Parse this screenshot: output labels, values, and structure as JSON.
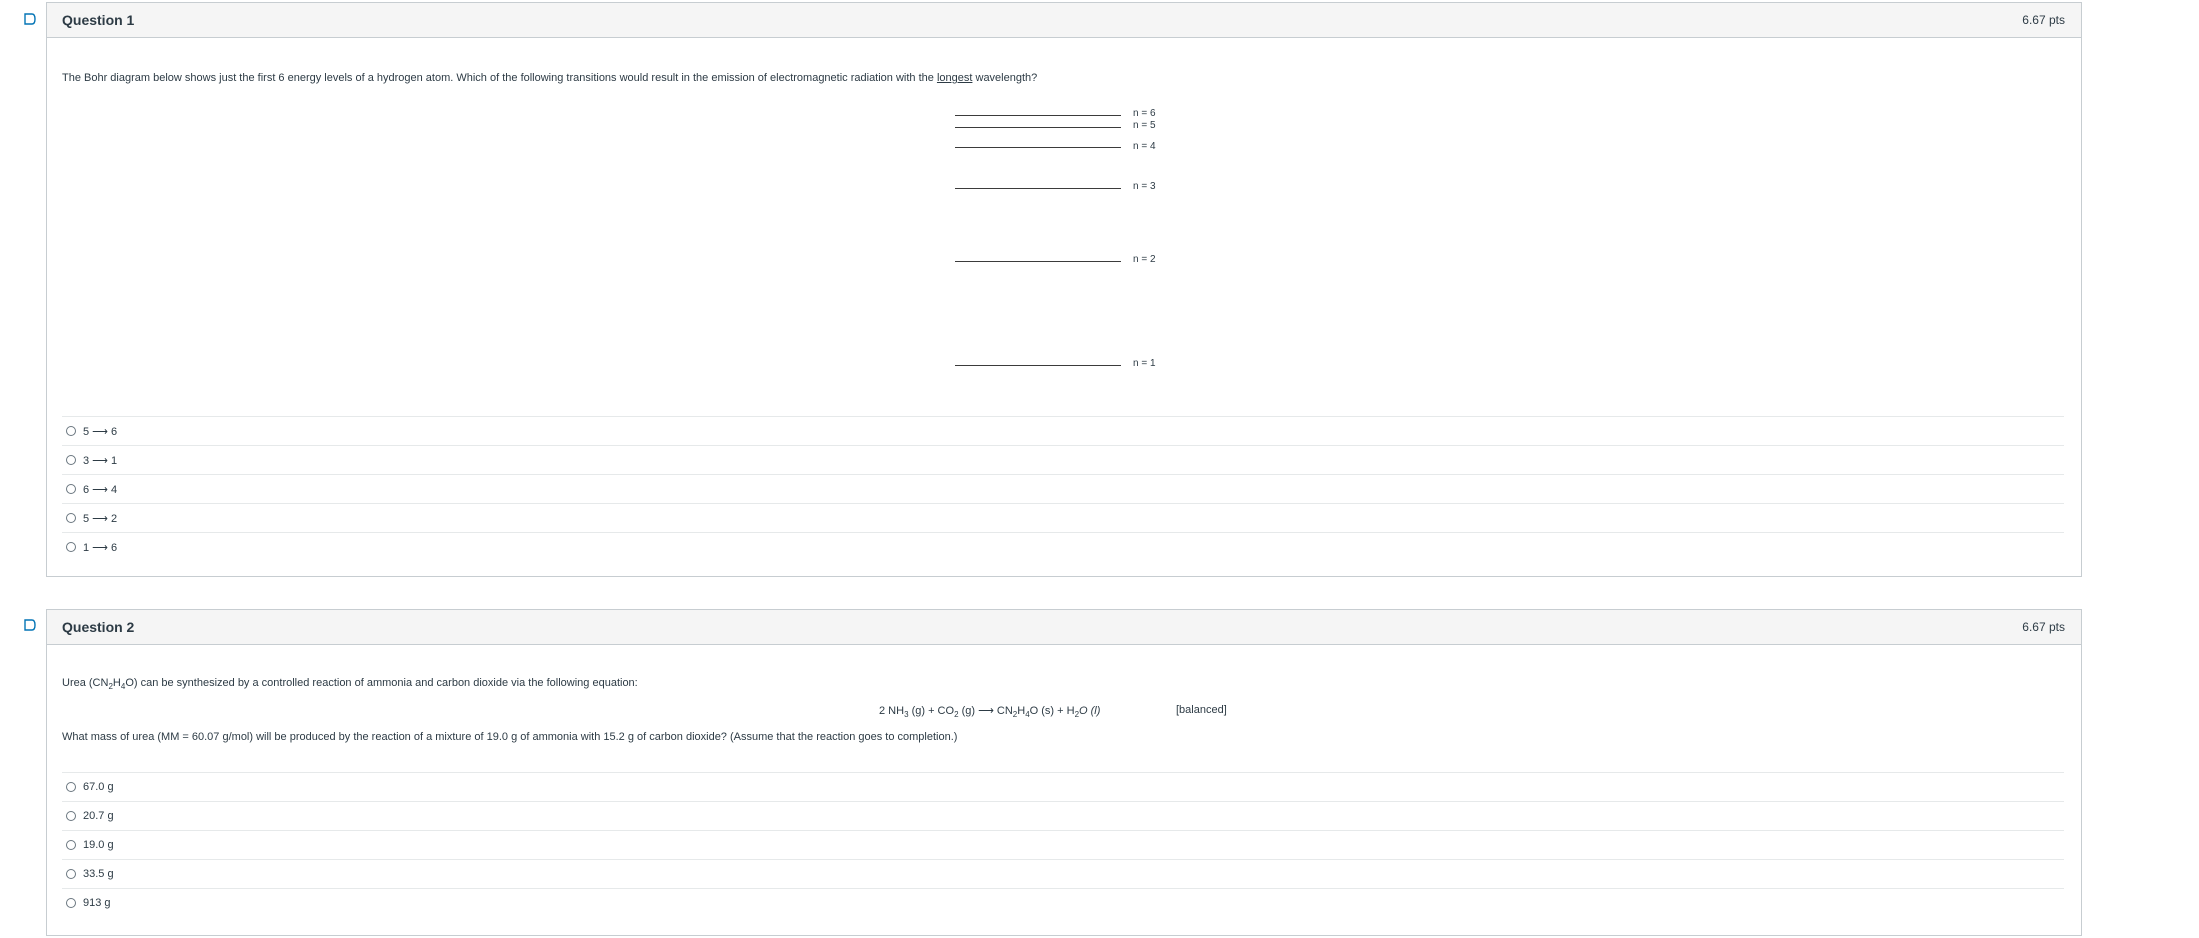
{
  "q1": {
    "title": "Question 1",
    "points": "6.67 pts",
    "text_before": "The Bohr diagram below shows just the first 6 energy levels of a hydrogen atom. Which of the following transitions would result in the emission of electromagnetic radiation with the ",
    "text_underlined": "longest",
    "text_after": " wavelength?",
    "levels": [
      "n = 6",
      "n = 5",
      "n = 4",
      "n = 3",
      "n = 2",
      "n = 1"
    ],
    "options": [
      "5 ⟶ 6",
      "3 ⟶ 1",
      "6 ⟶ 4",
      "5 ⟶ 2",
      "1 ⟶ 6"
    ]
  },
  "q2": {
    "title": "Question 2",
    "points": "6.67 pts",
    "intro_a": "Urea (CN",
    "intro_sub1": "2",
    "intro_b": "H",
    "intro_sub2": "4",
    "intro_c": "O) can be synthesized by a controlled reaction of ammonia and carbon dioxide via the following equation:",
    "eq_a": "2 NH",
    "eq_sub1": "3",
    "eq_b": " (g)  +  CO",
    "eq_sub2": "2",
    "eq_c": " (g) ⟶  CN",
    "eq_sub3": "2",
    "eq_d": "H",
    "eq_sub4": "4",
    "eq_e": "O (s)  +  H",
    "eq_sub5": "2",
    "eq_f": "O (l)",
    "eq_note": "[balanced]",
    "question": "What mass of urea (MM = 60.07 g/mol) will be produced by the reaction of a mixture of 19.0 g of ammonia with 15.2 g of carbon dioxide? (Assume that the reaction goes to completion.)",
    "options": [
      "67.0 g",
      "20.7 g",
      "19.0 g",
      "33.5 g",
      "913 g"
    ]
  }
}
